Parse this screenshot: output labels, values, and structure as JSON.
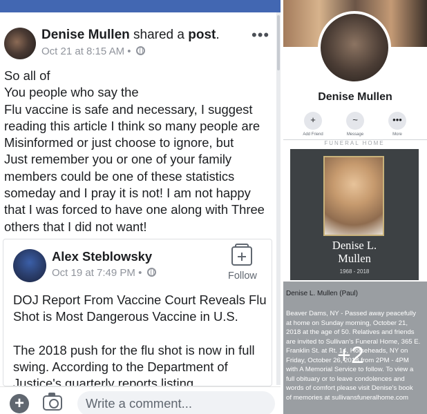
{
  "post": {
    "author": "Denise Mullen",
    "action_pre": "shared a",
    "action_obj": "post",
    "action_end": ".",
    "timestamp": "Oct 21 at 8:15 AM",
    "separator": "•",
    "more_icon": "more-dots-icon",
    "body_lines": [
      "So all of",
      "You people who say the",
      "Flu vaccine is safe and necessary, I suggest",
      "reading this article I think so many people are",
      "Misinformed or just choose to ignore, but",
      "Just remember you or one of your family",
      "members could be one of these statistics",
      "someday and I pray it is not! I am not happy",
      "that I was forced to have one along with Three",
      "others that I did not want!"
    ]
  },
  "shared_post": {
    "author": "Alex Steblowsky",
    "timestamp": "Oct 19 at 7:49 PM",
    "separator": "•",
    "follow_label": "Follow",
    "body_lines": [
      "DOJ Report From Vaccine Court Reveals Flu",
      "Shot is Most Dangerous Vaccine in U.S.",
      "",
      "The 2018 push for the flu shot is now in full",
      "swing. According to the Department of",
      "Justice's quarterly reports listing"
    ]
  },
  "comment_bar": {
    "placeholder": "Write a comment...",
    "plus_icon": "plus-icon",
    "camera_icon": "camera-icon"
  },
  "profile": {
    "name": "Denise Mullen",
    "actions": [
      {
        "label": "Add Friend",
        "icon": "add-friend-icon",
        "glyph": "+"
      },
      {
        "label": "Message",
        "icon": "messenger-icon",
        "glyph": "~"
      },
      {
        "label": "More",
        "icon": "more-icon",
        "glyph": "•••"
      }
    ]
  },
  "obituary": {
    "header": "FUNERAL HOME",
    "name_line1": "Denise L.",
    "name_line2": "Mullen",
    "years": "1968 - 2018",
    "heading": "Denise L. Mullen (Paul)",
    "body_lines": [
      "Beaver Dams, NY - Passed away peacefully",
      "at home on Sunday morning, October 21,",
      "2018 at the age of 50. Relatives and friends",
      "are invited to Sullivan's Funeral Home, 365 E.",
      "Franklin St. at Rt. 14, Horseheads, NY on",
      "Friday, October 26, 2018 from 2PM - 4PM",
      "with A Memorial Service to follow. To view a",
      "full obituary or to leave condolences and",
      "words of comfort please visit Denise's book",
      "of memories at sullivansfuneralhome.com"
    ],
    "more_photos": "+2"
  }
}
